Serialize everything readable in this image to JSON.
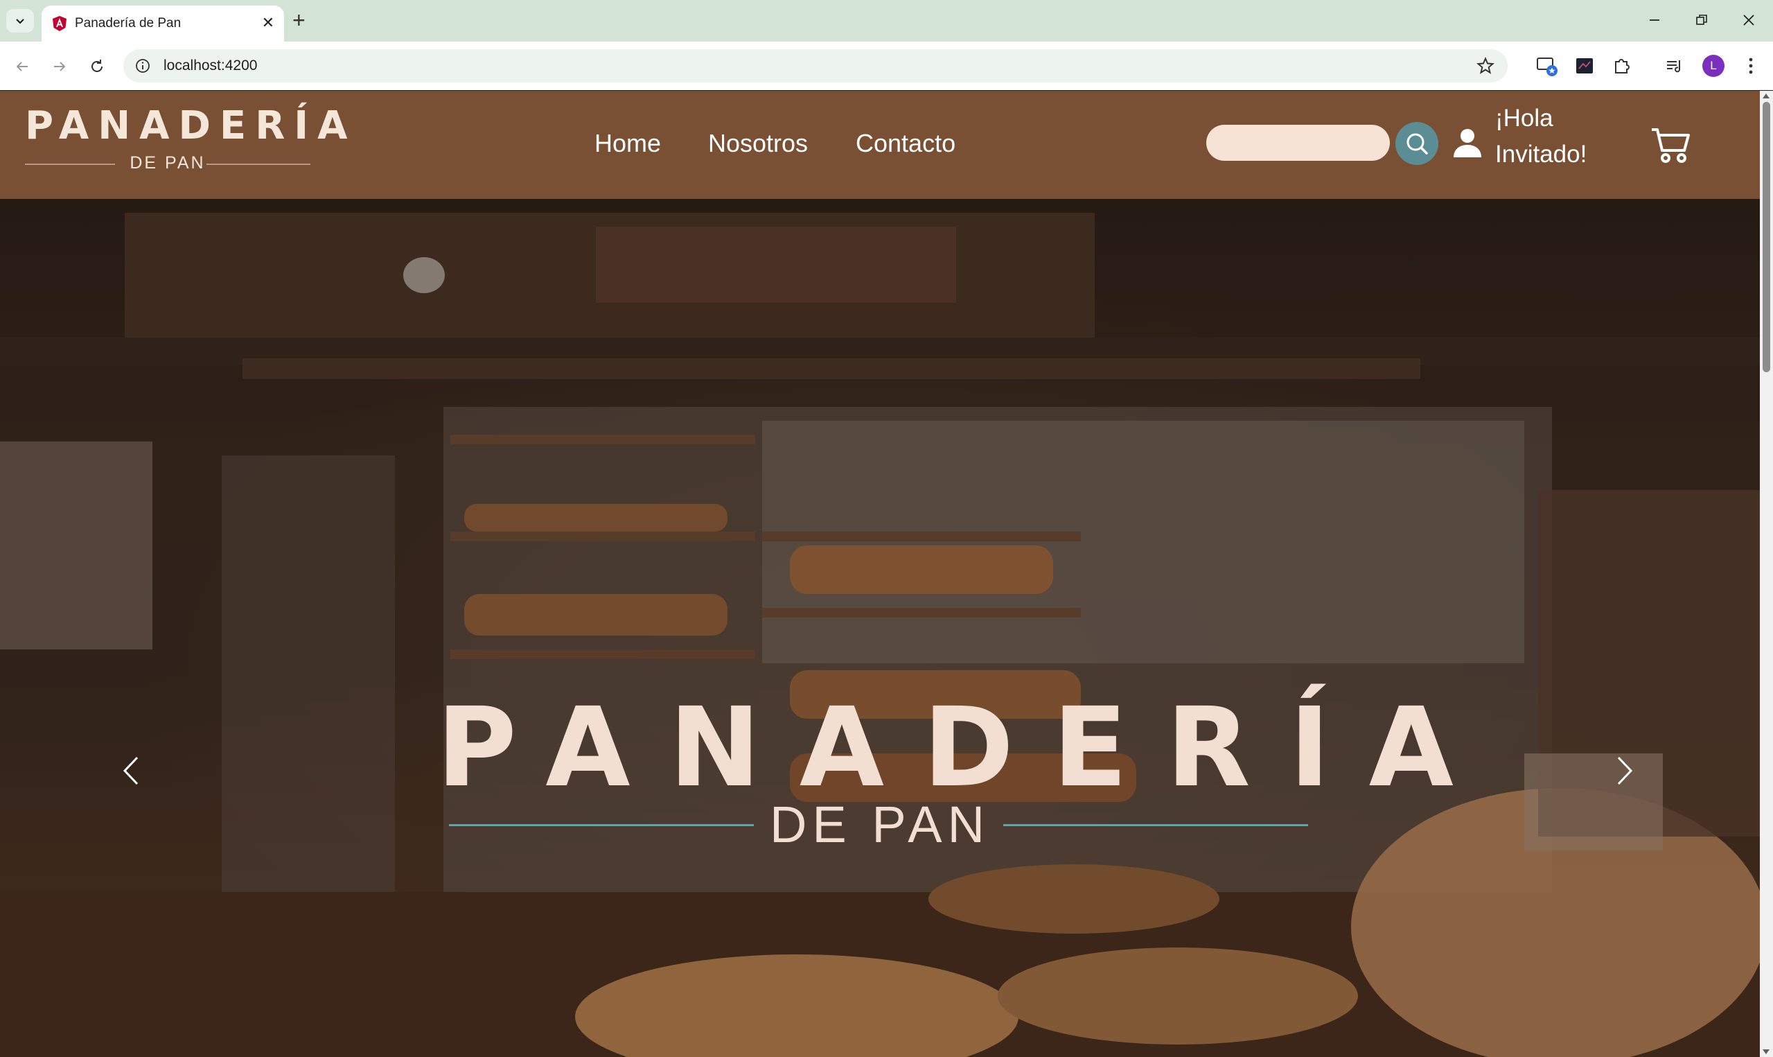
{
  "browser": {
    "tab_title": "Panadería de Pan",
    "url": "localhost:4200",
    "profile_initial": "L"
  },
  "site": {
    "logo_main": "PANADERÍA",
    "logo_sub": "DE PAN",
    "nav": [
      "Home",
      "Nosotros",
      "Contacto"
    ],
    "search_placeholder": "",
    "greeting": "¡Hola Invitado!",
    "colors": {
      "header": "#7a5034",
      "accent": "#5b8d94",
      "cream": "#f5e6da"
    }
  },
  "hero": {
    "title": "PANADERÍA",
    "subtitle": "DE PAN",
    "prev_icon": "chevron-left-icon",
    "next_icon": "chevron-right-icon"
  }
}
